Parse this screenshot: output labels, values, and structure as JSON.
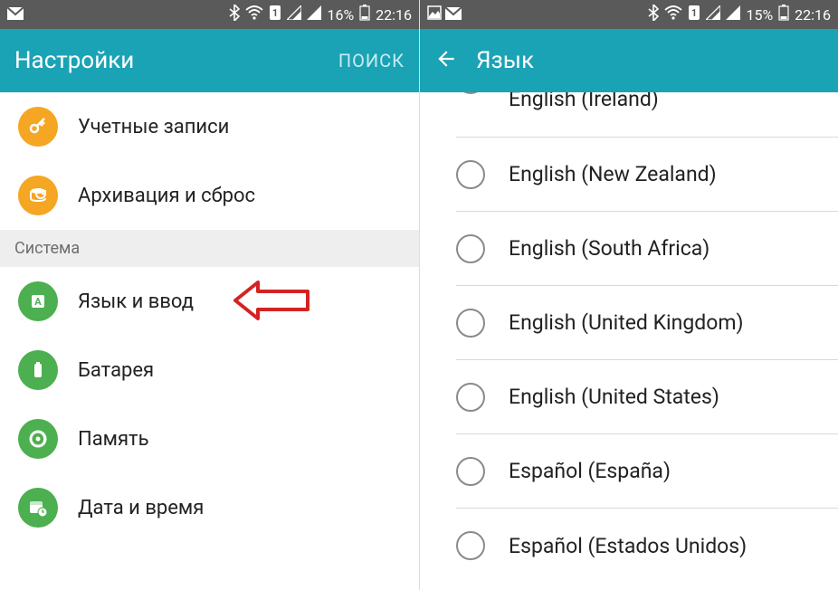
{
  "left": {
    "status": {
      "battery_pct": "16%",
      "time": "22:16"
    },
    "appbar": {
      "title": "Настройки",
      "search": "ПОИСК"
    },
    "rows": [
      {
        "label": "Учетные записи"
      },
      {
        "label": "Архивация и сброс"
      }
    ],
    "section": "Система",
    "rows2": [
      {
        "label": "Язык и ввод"
      },
      {
        "label": "Батарея"
      },
      {
        "label": "Память"
      },
      {
        "label": "Дата и время"
      }
    ]
  },
  "right": {
    "status": {
      "battery_pct": "15%",
      "time": "22:16"
    },
    "appbar": {
      "title": "Язык"
    },
    "langs": [
      "English (Ireland)",
      "English (New Zealand)",
      "English (South Africa)",
      "English (United Kingdom)",
      "English (United States)",
      "Español (España)",
      "Español (Estados Unidos)"
    ]
  },
  "annotation": {
    "points_to": "Язык и ввод",
    "color": "#d32323"
  }
}
